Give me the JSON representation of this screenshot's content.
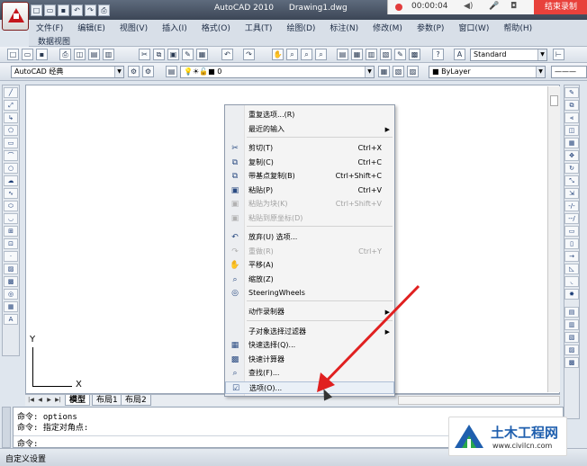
{
  "window": {
    "app_name": "AutoCAD 2010",
    "document": "Drawing1.dwg"
  },
  "recorder": {
    "time": "00:00:04",
    "stop_label": "结束录制"
  },
  "menubar": {
    "items": [
      "文件(F)",
      "编辑(E)",
      "视图(V)",
      "插入(I)",
      "格式(O)",
      "工具(T)",
      "绘图(D)",
      "标注(N)",
      "修改(M)",
      "参数(P)",
      "窗口(W)",
      "帮助(H)"
    ],
    "workspace_tab": "数据视图"
  },
  "toolbar": {
    "workspace": "AutoCAD 经典",
    "text_style": "Standard",
    "layer": "0",
    "color": "ByLayer"
  },
  "context_menu": {
    "items": [
      {
        "label": "重复选项...(R)",
        "shortcut": "",
        "icon": "",
        "disabled": false,
        "submenu": false
      },
      {
        "label": "最近的输入",
        "shortcut": "",
        "icon": "",
        "disabled": false,
        "submenu": true
      },
      {
        "label": "剪切(T)",
        "shortcut": "Ctrl+X",
        "icon": "cut-icon",
        "disabled": false,
        "submenu": false
      },
      {
        "label": "复制(C)",
        "shortcut": "Ctrl+C",
        "icon": "copy-icon",
        "disabled": false,
        "submenu": false
      },
      {
        "label": "带基点复制(B)",
        "shortcut": "Ctrl+Shift+C",
        "icon": "copy-base-icon",
        "disabled": false,
        "submenu": false
      },
      {
        "label": "粘贴(P)",
        "shortcut": "Ctrl+V",
        "icon": "paste-icon",
        "disabled": false,
        "submenu": false
      },
      {
        "label": "粘贴为块(K)",
        "shortcut": "Ctrl+Shift+V",
        "icon": "paste-block-icon",
        "disabled": true,
        "submenu": false
      },
      {
        "label": "粘贴到原坐标(D)",
        "shortcut": "",
        "icon": "paste-coords-icon",
        "disabled": true,
        "submenu": false
      },
      {
        "label": "放弃(U) 选项...",
        "shortcut": "",
        "icon": "undo-icon",
        "disabled": false,
        "submenu": false
      },
      {
        "label": "重做(R)",
        "shortcut": "Ctrl+Y",
        "icon": "redo-icon",
        "disabled": true,
        "submenu": false
      },
      {
        "label": "平移(A)",
        "shortcut": "",
        "icon": "pan-icon",
        "disabled": false,
        "submenu": false
      },
      {
        "label": "缩放(Z)",
        "shortcut": "",
        "icon": "zoom-icon",
        "disabled": false,
        "submenu": false
      },
      {
        "label": "SteeringWheels",
        "shortcut": "",
        "icon": "steering-wheel-icon",
        "disabled": false,
        "submenu": false
      },
      {
        "label": "动作录制器",
        "shortcut": "",
        "icon": "",
        "disabled": false,
        "submenu": true
      },
      {
        "label": "子对象选择过滤器",
        "shortcut": "",
        "icon": "",
        "disabled": false,
        "submenu": true
      },
      {
        "label": "快速选择(Q)...",
        "shortcut": "",
        "icon": "quick-select-icon",
        "disabled": false,
        "submenu": false
      },
      {
        "label": "快速计算器",
        "shortcut": "",
        "icon": "calculator-icon",
        "disabled": false,
        "submenu": false
      },
      {
        "label": "查找(F)...",
        "shortcut": "",
        "icon": "find-icon",
        "disabled": false,
        "submenu": false
      },
      {
        "label": "选项(O)...",
        "shortcut": "",
        "icon": "options-check-icon",
        "disabled": false,
        "submenu": false
      }
    ]
  },
  "ucs": {
    "x_label": "X",
    "y_label": "Y"
  },
  "layout_tabs": [
    "模型",
    "布局1",
    "布局2"
  ],
  "command": {
    "line1": "命令:  options",
    "line2": "命令: 指定对角点:",
    "prompt": "命令:"
  },
  "statusbar": {
    "text": "自定义设置"
  },
  "watermark": {
    "title": "土木工程网",
    "url": "www.civilcn.com"
  },
  "colors": {
    "accent_red": "#e8413b",
    "arrow_red": "#e02020",
    "brand_blue": "#1f5fae"
  }
}
